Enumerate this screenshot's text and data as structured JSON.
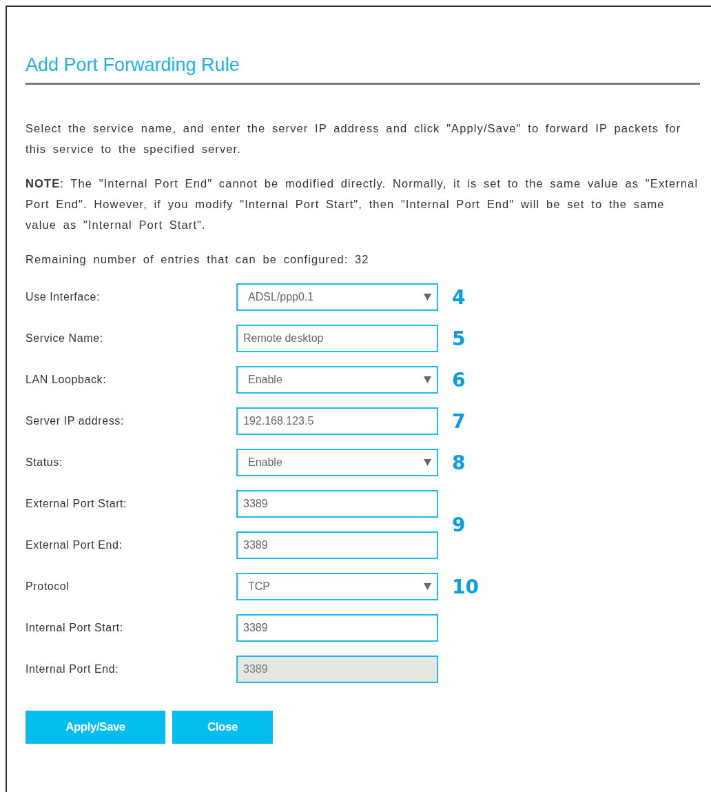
{
  "title": "Add Port Forwarding Rule",
  "paragraphs": [
    "Select the service name, and enter the server IP address and click \"Apply/Save\" to forward IP packets for this service to the specified server.",
    "**NOTE**: The \"Internal Port End\" cannot be modified directly. Normally, it is set to the same value as \"External Port End\". However, if you modify \"Internal Port Start\", then \"Internal Port End\" will be set to the same value as \"Internal Port Start\".",
    "Remaining number of entries that can be configured: 32"
  ],
  "fields": [
    {
      "label": "Use Interface:",
      "kind": "select",
      "value": "ADSL/ppp0.1",
      "marker": "4"
    },
    {
      "label": "Service Name:",
      "kind": "text",
      "value": "Remote desktop",
      "disabled": false,
      "marker": "5"
    },
    {
      "label": "LAN Loopback:",
      "kind": "select",
      "value": "Enable",
      "marker": "6"
    },
    {
      "label": "Server IP address:",
      "kind": "text",
      "value": "192.168.123.5",
      "disabled": false,
      "marker": "7"
    },
    {
      "label": "Status:",
      "kind": "select",
      "value": "Enable",
      "marker": "8"
    },
    {
      "label": "External Port Start:",
      "kind": "text",
      "value": "3389",
      "disabled": false,
      "marker": "9",
      "marker_spans_next": true
    },
    {
      "label": "External Port End:",
      "kind": "text",
      "value": "3389",
      "disabled": false
    },
    {
      "label": "Protocol",
      "kind": "select",
      "value": "TCP",
      "marker": "10"
    },
    {
      "label": "Internal Port Start:",
      "kind": "text",
      "value": "3389",
      "disabled": false
    },
    {
      "label": "Internal Port End:",
      "kind": "text",
      "value": "3389",
      "disabled": true
    }
  ],
  "buttons": [
    {
      "label": "Apply/Save",
      "kind": "primary"
    },
    {
      "label": "Close",
      "kind": "secondary"
    }
  ]
}
